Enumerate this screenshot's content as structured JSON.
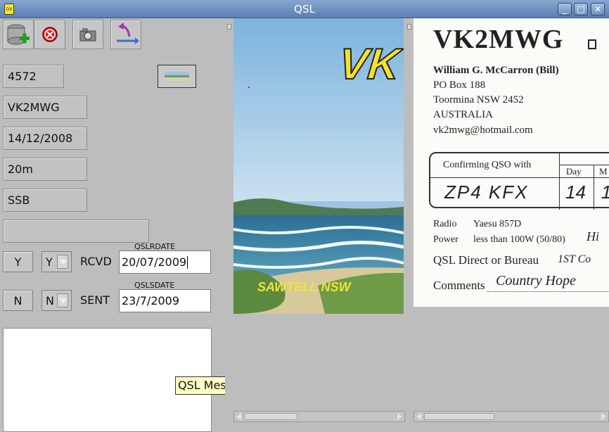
{
  "window": {
    "title": "QSL",
    "icon_text": "DX"
  },
  "toolbar": {
    "buttons": [
      {
        "icon": "database-add-icon"
      },
      {
        "icon": "delete-icon"
      },
      {
        "icon": "camera-icon"
      },
      {
        "icon": "swap-arrow-icon"
      }
    ]
  },
  "record": {
    "id": "4572",
    "callsign": "VK2MWG",
    "date": "14/12/2008",
    "band": "20m",
    "mode": "SSB",
    "extra": ""
  },
  "qsl": {
    "rcvd_button": "Y",
    "rcvd_select": "Y",
    "rcvd_label": "RCVD",
    "rcvd_date_label": "QSLRDATE",
    "rcvd_date": "20/07/2009",
    "sent_button": "N",
    "sent_select": "N",
    "sent_label": "SENT",
    "sent_date_label": "QSLSDATE",
    "sent_date": "23/7/2009",
    "message_tooltip": "QSL Message"
  },
  "card_front": {
    "callsign_partial": "VK",
    "location": "SAWTELL NSW"
  },
  "card_back": {
    "callsign": "VK2MWG",
    "name": "William G. McCarron  (Bill)",
    "address_line1": "PO Box 188",
    "address_line2": "Toormina NSW 2452",
    "country": "AUSTRALIA",
    "email": "vk2mwg@hotmail.com",
    "confirming_label": "Confirming QSO with",
    "day_label": "Day",
    "month_partial": "M",
    "qso_callsign": "ZP4 KFX",
    "qso_day": "14",
    "qso_month_partial": "1",
    "radio_label": "Radio",
    "radio_value": "Yaesu 857D",
    "power_label": "Power",
    "power_value": "less than 100W (50/80)",
    "power_note": "Hi",
    "qsl_route": "QSL Direct or Bureau",
    "qsl_route_note": "1ST Co",
    "comments_label": "Comments",
    "comments_value": "Country Hope"
  },
  "colors": {
    "titlebar": "#6f90bd",
    "panel": "#bdbdbd",
    "tooltip": "#ffffc6",
    "callsign_yellow": "#f5e22a"
  }
}
